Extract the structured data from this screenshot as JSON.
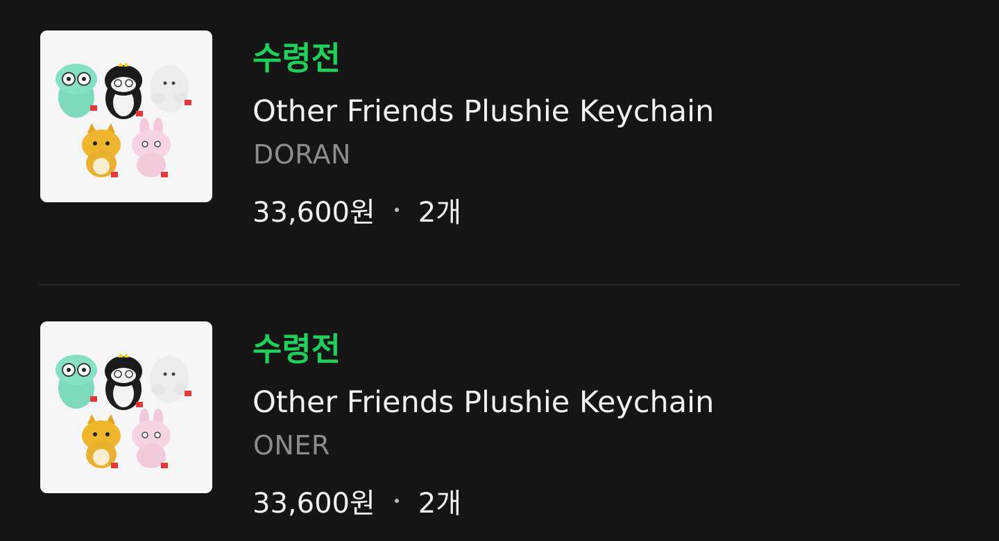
{
  "orders": [
    {
      "status": "수령전",
      "product_name": "Other Friends Plushie Keychain",
      "option": "DORAN",
      "price": "33,600원",
      "quantity": "2개",
      "status_color": "#1fcf5c"
    },
    {
      "status": "수령전",
      "product_name": "Other Friends Plushie Keychain",
      "option": "ONER",
      "price": "33,600원",
      "quantity": "2개",
      "status_color": "#1fcf5c"
    }
  ]
}
